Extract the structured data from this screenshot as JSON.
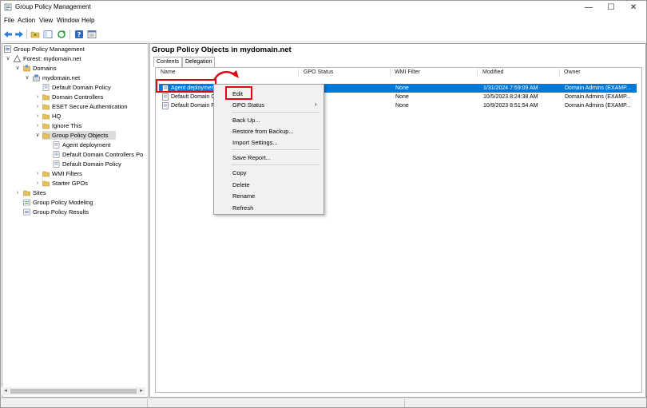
{
  "window": {
    "title": "Group Policy Management",
    "minimize": "—",
    "maximize": "☐",
    "close": "✕"
  },
  "menu": [
    "File",
    "Action",
    "View",
    "Window",
    "Help"
  ],
  "tree": {
    "root": "Group Policy Management",
    "forest": "Forest: mydomain.net",
    "domains": "Domains",
    "domain": "mydomain.net",
    "domain_children": [
      "Default Domain Policy",
      "Domain Controllers",
      "ESET Secure Authentication",
      "HQ",
      "Ignore This"
    ],
    "gpo_folder": "Group Policy Objects",
    "gpo_children": [
      "Agent deployment",
      "Default Domain Controllers Po",
      "Default Domain Policy"
    ],
    "after_gpo": [
      "WMI Filters",
      "Starter GPOs"
    ],
    "forest_children": [
      "Sites",
      "Group Policy Modeling",
      "Group Policy Results"
    ]
  },
  "right": {
    "title": "Group Policy Objects in mydomain.net",
    "tabs": [
      "Contents",
      "Delegation"
    ],
    "columns": [
      "Name",
      "GPO Status",
      "WMI Filter",
      "Modified",
      "Owner"
    ],
    "rows": [
      {
        "name": "Agent deployment",
        "wmi": "None",
        "modified": "1/31/2024 7:59:09 AM",
        "owner": "Domain Admins (EXAMP..."
      },
      {
        "name": "Default Domain Co",
        "wmi": "None",
        "modified": "10/5/2023 8:24:38 AM",
        "owner": "Domain Admins (EXAMP..."
      },
      {
        "name": "Default Domain Po",
        "wmi": "None",
        "modified": "10/9/2023 8:51:54 AM",
        "owner": "Domain Admins (EXAMP..."
      }
    ]
  },
  "context_menu": {
    "items": [
      "Edit",
      "GPO Status",
      "Back Up...",
      "Restore from Backup...",
      "Import Settings...",
      "Save Report...",
      "Copy",
      "Delete",
      "Rename",
      "Refresh"
    ],
    "submenu_chevron": "›"
  },
  "colors": {
    "selection": "#0078d7",
    "highlight": "#e3000f",
    "folder": "#e8c15a"
  },
  "icons": [
    "back-arrow-icon",
    "forward-arrow-icon",
    "folder-up-icon",
    "console-tree-icon",
    "refresh-icon",
    "help-icon",
    "properties-icon"
  ]
}
